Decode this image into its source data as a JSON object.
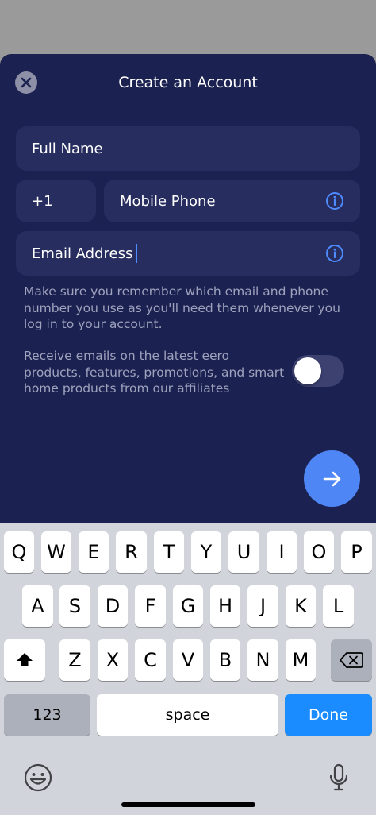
{
  "header": {
    "title": "Create an Account"
  },
  "form": {
    "full_name_placeholder": "Full Name",
    "country_code": "+1",
    "mobile_placeholder": "Mobile Phone",
    "email_placeholder": "Email Address",
    "note": "Make sure you remember which email and phone number you use as you'll need them whenever you log in to your account.",
    "marketing_label": "Receive emails on the latest eero products, features, promotions, and smart home products from our affiliates",
    "marketing_opt_in": false
  },
  "keyboard": {
    "row1": [
      "Q",
      "W",
      "E",
      "R",
      "T",
      "Y",
      "U",
      "I",
      "O",
      "P"
    ],
    "row2": [
      "A",
      "S",
      "D",
      "F",
      "G",
      "H",
      "J",
      "K",
      "L"
    ],
    "row3": [
      "Z",
      "X",
      "C",
      "V",
      "B",
      "N",
      "M"
    ],
    "numbers_label": "123",
    "space_label": "space",
    "done_label": "Done"
  },
  "icons": {
    "close": "close-icon",
    "info": "info-icon",
    "next": "arrow-right-icon",
    "shift": "shift-icon",
    "backspace": "backspace-icon",
    "emoji": "emoji-icon",
    "mic": "microphone-icon"
  },
  "colors": {
    "sheet_bg": "#1b2150",
    "field_bg": "#272d5f",
    "accent": "#4f86f6",
    "done_key": "#1a8cff"
  }
}
